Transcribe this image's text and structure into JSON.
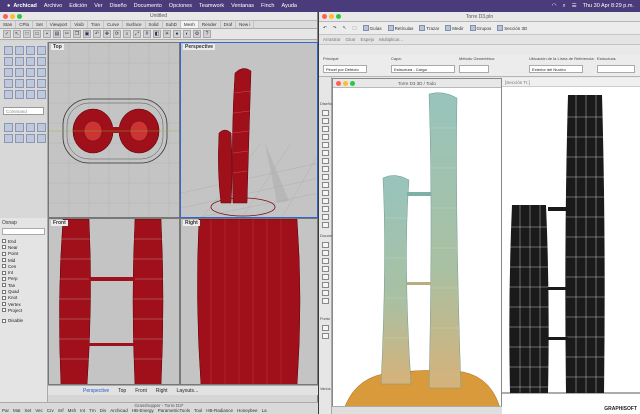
{
  "menubar": {
    "app": "Archicad",
    "items": [
      "Archivo",
      "Edición",
      "Ver",
      "Diseño",
      "Documento",
      "Opciones",
      "Teamwork",
      "Ventanas",
      "Finch",
      "Ayuda"
    ],
    "clock": "Thu 30 Apr  8:29 p.m."
  },
  "rhino": {
    "title": "Untitled",
    "tabs": [
      "Stan",
      "CPla",
      "Set",
      "Viewport",
      "Visib",
      "Tran",
      "Curve",
      "Surface",
      "Solid",
      "SubD",
      "Mesh",
      "Render",
      "Draf",
      "New i"
    ],
    "command_placeholder": "Command",
    "viewports": {
      "top": "Top",
      "perspective": "Perspective",
      "front": "Front",
      "right": "Right"
    },
    "osnap": {
      "title": "Osnap",
      "filter": "",
      "items": [
        "End",
        "Near",
        "Point",
        "Mid",
        "Cen",
        "Int",
        "Perp",
        "Tan",
        "Quad",
        "Knot",
        "Vertex",
        "Project"
      ],
      "disable": "Disable"
    },
    "viewport_tabs": [
      "Perspective",
      "Top",
      "Front",
      "Right",
      "Layouts..."
    ],
    "grasshopper_title": "Grasshopper - Torre D3*",
    "gh_tabs": [
      "Par",
      "Mat",
      "Set",
      "Vec",
      "Crv",
      "Srf",
      "Msh",
      "Int",
      "Trn",
      "Dis",
      "Archicad",
      "HB-Energy",
      "ParametricTools",
      "Tool",
      "HB-Radiance",
      "Honeybee",
      "La"
    ]
  },
  "archicad": {
    "title": "Torre D3.pln",
    "main_toolbar": [
      "Guías",
      "Retículas",
      "Trazar",
      "Medir",
      "Grupos",
      "Sección 3D"
    ],
    "secondary_toolbar": [
      "Arrastrar",
      "Girar",
      "Espejo",
      "Multiplicar..."
    ],
    "infobox": {
      "principal_label": "Principal",
      "principal_value": "Pincel por Defecto",
      "capa_label": "Capa:",
      "capa_value": "Estructura - Carga",
      "metodo_label": "Método Geométrico:",
      "ubicacion_label": "Ubicación de la Línea de Referencia:",
      "ubicacion_value": "Exterior del Nucleo",
      "estructura_label": "Estructura:"
    },
    "view3d_title": "Torre D3 3D / Todo",
    "toolbox_sections": [
      "Diseño",
      "Docum",
      "Varios",
      "Punto"
    ],
    "plan_header": "[Sección Tr.]",
    "brand": "GRAPHISOFT"
  },
  "colors": {
    "menubar": "#4a3c7a",
    "rhino_red": "#a0101a",
    "tower_green": "#8fbab3",
    "podium_orange": "#d89a3a"
  }
}
